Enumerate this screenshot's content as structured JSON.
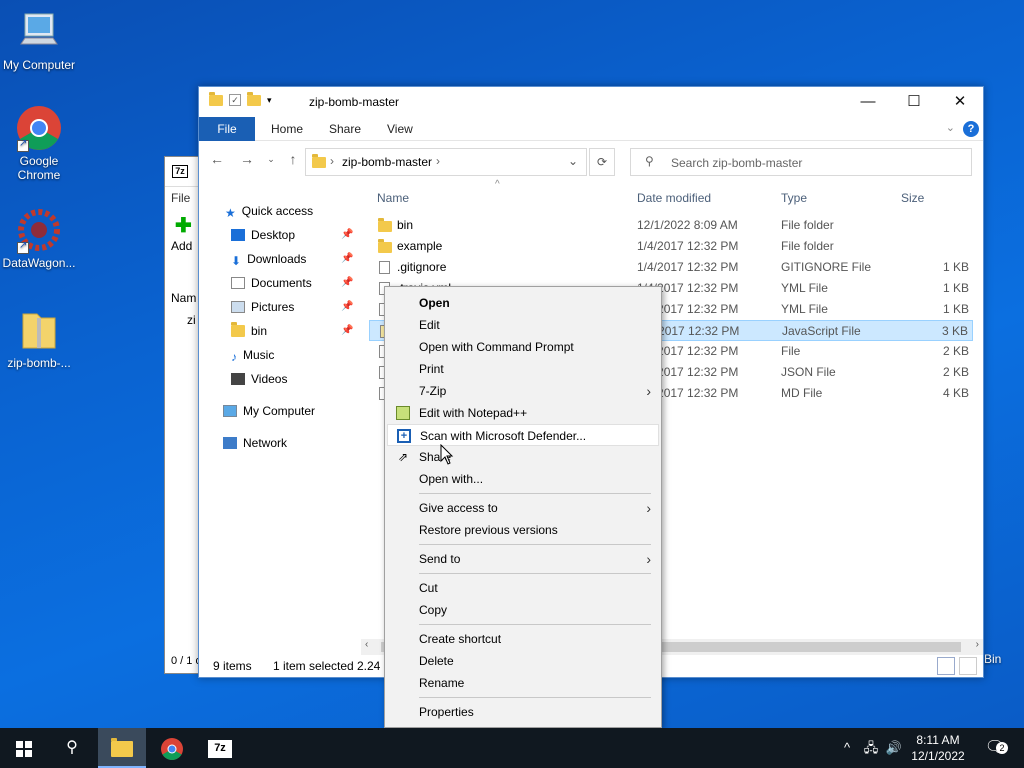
{
  "desktop": {
    "icons": [
      {
        "label": "My Computer"
      },
      {
        "label": "Google Chrome"
      },
      {
        "label": "DataWagon..."
      },
      {
        "label": "zip-bomb-..."
      }
    ],
    "recycle_label": "Bin"
  },
  "back_window": {
    "logo": "7z",
    "menu_file": "File",
    "add_label": "Add",
    "col_name": "Nam",
    "row_label": "zi",
    "status": "0 / 1 o"
  },
  "explorer": {
    "title": "zip-bomb-master",
    "ribbon": {
      "file": "File",
      "home": "Home",
      "share": "Share",
      "view": "View"
    },
    "address": "zip-bomb-master",
    "search_placeholder": "Search zip-bomb-master",
    "nav": [
      {
        "label": "Quick access",
        "pinned": false
      },
      {
        "label": "Desktop",
        "pinned": true
      },
      {
        "label": "Downloads",
        "pinned": true
      },
      {
        "label": "Documents",
        "pinned": true
      },
      {
        "label": "Pictures",
        "pinned": true
      },
      {
        "label": "bin",
        "pinned": true
      },
      {
        "label": "Music",
        "pinned": false
      },
      {
        "label": "Videos",
        "pinned": false
      },
      {
        "label": "My Computer",
        "pinned": false
      },
      {
        "label": "Network",
        "pinned": false
      }
    ],
    "columns": {
      "name": "Name",
      "date": "Date modified",
      "type": "Type",
      "size": "Size"
    },
    "files": [
      {
        "name": "bin",
        "date": "12/1/2022 8:09 AM",
        "type": "File folder",
        "size": "",
        "kind": "folder"
      },
      {
        "name": "example",
        "date": "1/4/2017 12:32 PM",
        "type": "File folder",
        "size": "",
        "kind": "folder"
      },
      {
        "name": ".gitignore",
        "date": "1/4/2017 12:32 PM",
        "type": "GITIGNORE File",
        "size": "1 KB",
        "kind": "file"
      },
      {
        "name": ".travis.yml",
        "date": "1/4/2017 12:32 PM",
        "type": "YML File",
        "size": "1 KB",
        "kind": "file"
      },
      {
        "name": "",
        "date": "1/4/2017 12:32 PM",
        "type": "YML File",
        "size": "1 KB",
        "kind": "file"
      },
      {
        "name": "",
        "date": "1/4/2017 12:32 PM",
        "type": "JavaScript File",
        "size": "3 KB",
        "kind": "file",
        "selected": true
      },
      {
        "name": "",
        "date": "1/4/2017 12:32 PM",
        "type": "File",
        "size": "2 KB",
        "kind": "file"
      },
      {
        "name": "",
        "date": "1/4/2017 12:32 PM",
        "type": "JSON File",
        "size": "2 KB",
        "kind": "file"
      },
      {
        "name": "",
        "date": "1/4/2017 12:32 PM",
        "type": "MD File",
        "size": "4 KB",
        "kind": "file"
      }
    ],
    "status": {
      "items": "9 items",
      "selected": "1 item selected",
      "size": "2.24 K"
    }
  },
  "context_menu": {
    "items": [
      {
        "label": "Open",
        "bold": true
      },
      {
        "label": "Edit"
      },
      {
        "label": "Open with Command Prompt"
      },
      {
        "label": "Print"
      },
      {
        "label": "7-Zip",
        "submenu": true
      },
      {
        "label": "Edit with Notepad++",
        "icon": "notepad-icon"
      },
      {
        "label": "Scan with Microsoft Defender...",
        "icon": "defender-icon",
        "highlighted": true
      },
      {
        "label": "Share",
        "icon": "share-icon"
      },
      {
        "label": "Open with..."
      },
      {
        "label": "Give access to",
        "submenu": true
      },
      {
        "label": "Restore previous versions"
      },
      {
        "label": "Send to",
        "submenu": true
      },
      {
        "label": "Cut"
      },
      {
        "label": "Copy"
      },
      {
        "label": "Create shortcut"
      },
      {
        "label": "Delete"
      },
      {
        "label": "Rename"
      },
      {
        "label": "Properties"
      }
    ]
  },
  "taskbar": {
    "clock_time": "8:11 AM",
    "clock_date": "12/1/2022",
    "notification_count": "2"
  }
}
